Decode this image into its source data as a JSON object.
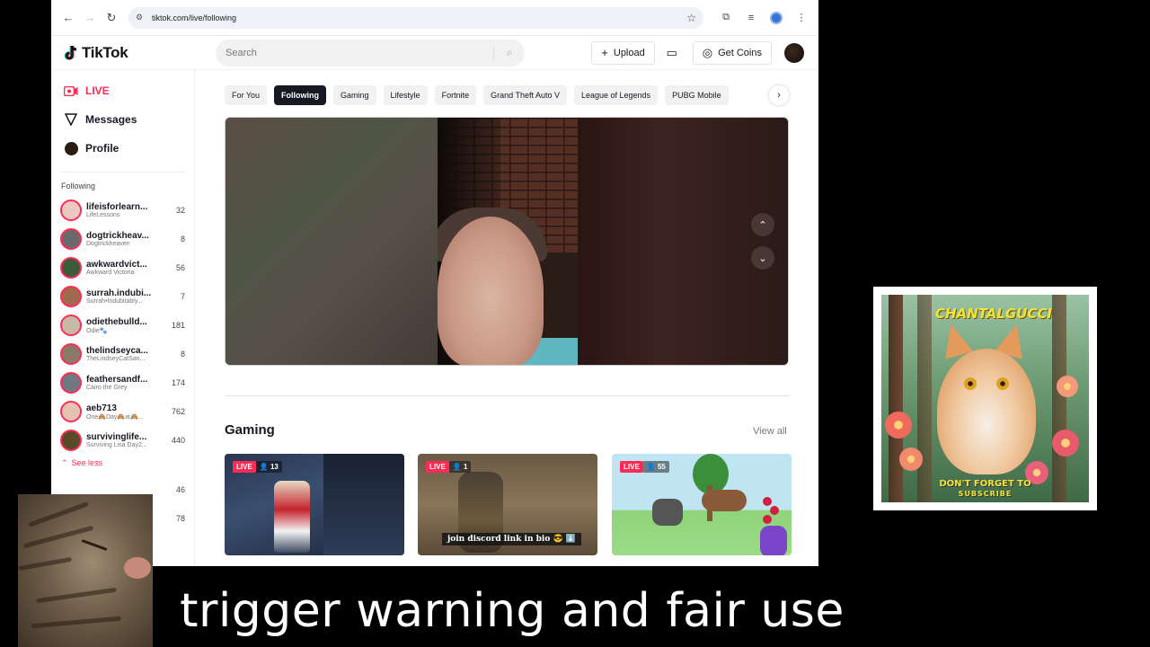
{
  "browser": {
    "url": "tiktok.com/live/following",
    "icons": [
      "back-icon",
      "forward-icon",
      "reload-icon",
      "site-settings-icon",
      "star-icon",
      "extensions-icon",
      "media-icon",
      "profile-icon",
      "menu-icon"
    ]
  },
  "header": {
    "logo_text": "TikTok",
    "search_placeholder": "Search",
    "upload_label": "Upload",
    "get_coins_label": "Get Coins"
  },
  "sidebar": {
    "main_items": [
      {
        "label": "LIVE",
        "icon": "live-icon"
      },
      {
        "label": "Messages",
        "icon": "messages-icon"
      },
      {
        "label": "Profile",
        "icon": "profile-icon"
      }
    ],
    "following_heading": "Following",
    "following": [
      {
        "name": "lifeisforlearn...",
        "sub": "LifeLessons",
        "count": "32",
        "color": "#e9c9c0"
      },
      {
        "name": "dogtrickheav...",
        "sub": "Dogtrickheaven",
        "count": "8",
        "color": "#6a6a6a"
      },
      {
        "name": "awkwardvict...",
        "sub": "Awkward Victoria",
        "count": "56",
        "color": "#3b5b3a"
      },
      {
        "name": "surrah.indubi...",
        "sub": "Surrah•Indubitably...",
        "count": "7",
        "color": "#a06a50"
      },
      {
        "name": "odiethebulld...",
        "sub": "Odie🐾",
        "count": "181",
        "color": "#c8b8a8"
      },
      {
        "name": "thelindseyca...",
        "sub": "TheLindseyCatSan...",
        "count": "8",
        "color": "#8a7a6a"
      },
      {
        "name": "feathersandf...",
        "sub": "Cairo the Grey",
        "count": "174",
        "color": "#707880"
      },
      {
        "name": "aeb713",
        "sub": "One🙈Day🙈at🙈...",
        "count": "762",
        "color": "#e6c2b5"
      },
      {
        "name": "survivinglife...",
        "sub": "Surviving Lisa Day2...",
        "count": "440",
        "color": "#5a4a2a"
      }
    ],
    "see_less": "See less",
    "extra_counts": [
      "46",
      "78"
    ]
  },
  "chips": [
    "For You",
    "Following",
    "Gaming",
    "Lifestyle",
    "Fortnite",
    "Grand Theft Auto V",
    "League of Legends",
    "PUBG Mobile"
  ],
  "active_chip": "Following",
  "gaming": {
    "title": "Gaming",
    "view_all": "View all",
    "cards": [
      {
        "live": "LIVE",
        "viewers": "13"
      },
      {
        "live": "LIVE",
        "viewers": "1",
        "caption": "join discord link in bio 😎 ⬇️"
      },
      {
        "live": "LIVE",
        "viewers": "55"
      }
    ]
  },
  "overlay": {
    "caption": "trigger warning and fair use",
    "subscribe_top": "CHANTALGUCCI",
    "subscribe_line1": "DON'T FORGET TO",
    "subscribe_line2": "SUBSCRIBE"
  },
  "colors": {
    "accent": "#fe2c55",
    "active_chip_bg": "#161823"
  }
}
